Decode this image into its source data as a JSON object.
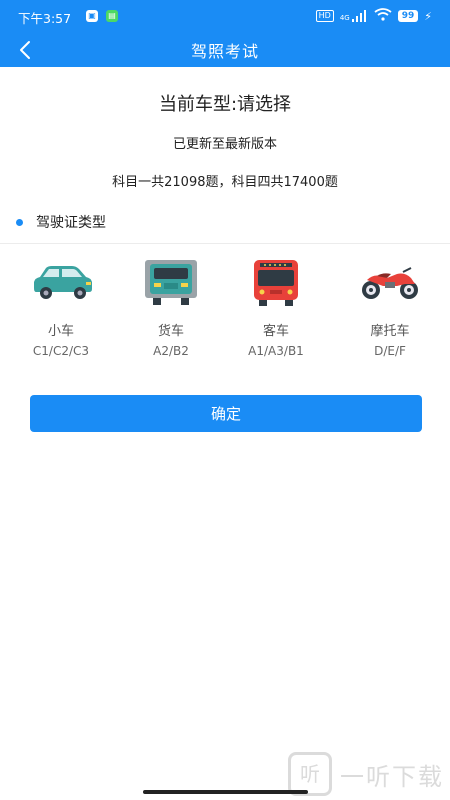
{
  "status_bar": {
    "time": "下午3:57",
    "hd": "HD",
    "network": "4G",
    "battery": "99"
  },
  "nav": {
    "title": "驾照考试",
    "back_icon": "chevron-left-icon"
  },
  "header": {
    "current_type": "当前车型:请选择",
    "update_note": "已更新至最新版本",
    "counts": "科目一共21098题，科目四共17400题"
  },
  "section": {
    "title": "驾驶证类型"
  },
  "vehicles": [
    {
      "name": "小车",
      "codes": "C1/C2/C3",
      "icon": "car-icon",
      "color": "#3aa3a0"
    },
    {
      "name": "货车",
      "codes": "A2/B2",
      "icon": "truck-icon",
      "color": "#3aa3a0"
    },
    {
      "name": "客车",
      "codes": "A1/A3/B1",
      "icon": "bus-icon",
      "color": "#e8413a"
    },
    {
      "name": "摩托车",
      "codes": "D/E/F",
      "icon": "motorcycle-icon",
      "color": "#e8413a"
    }
  ],
  "confirm_label": "确定",
  "watermark": {
    "logo_char": "听",
    "text": "一听下载"
  },
  "colors": {
    "accent": "#1a8cf5",
    "text": "#222222",
    "muted": "#666666"
  }
}
